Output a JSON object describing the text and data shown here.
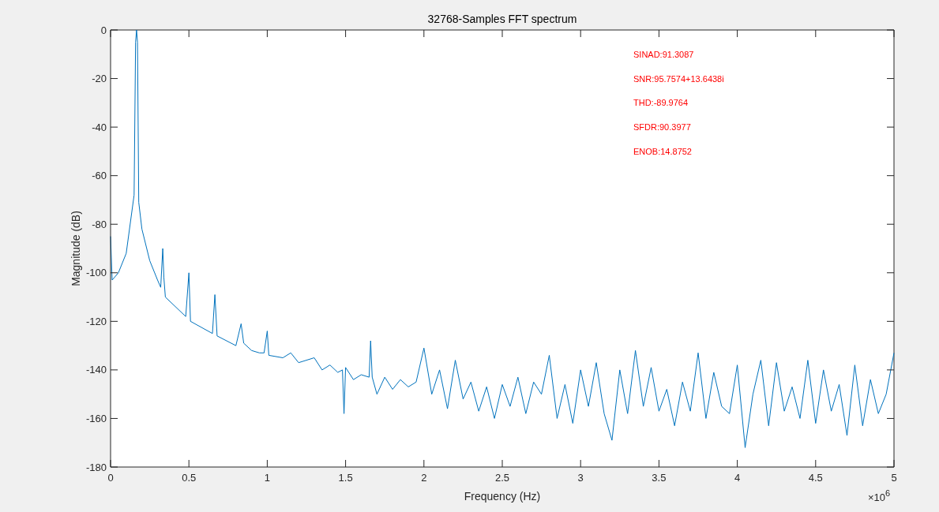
{
  "figure": {
    "x_exponent": "×10$^{6}$",
    "chart_data": {
      "type": "line",
      "title": "32768-Samples FFT spectrum",
      "xlabel": "Frequency (Hz)",
      "ylabel": "Magnitude (dB)",
      "x": [
        0,
        0.01,
        0.05,
        0.1,
        0.15,
        0.16,
        0.166,
        0.172,
        0.18,
        0.2,
        0.25,
        0.3,
        0.32,
        0.333,
        0.34,
        0.35,
        0.48,
        0.5,
        0.51,
        0.65,
        0.666,
        0.68,
        0.8,
        0.833,
        0.85,
        0.9,
        0.95,
        0.98,
        1.0,
        1.01,
        1.1,
        1.15,
        1.2,
        1.3,
        1.35,
        1.4,
        1.45,
        1.48,
        1.49,
        1.5,
        1.55,
        1.6,
        1.65,
        1.66,
        1.67,
        1.7,
        1.75,
        1.8,
        1.85,
        1.9,
        1.95,
        2.0,
        2.05,
        2.1,
        2.15,
        2.2,
        2.25,
        2.3,
        2.35,
        2.4,
        2.45,
        2.5,
        2.55,
        2.6,
        2.65,
        2.7,
        2.75,
        2.8,
        2.85,
        2.9,
        2.95,
        3.0,
        3.05,
        3.1,
        3.15,
        3.2,
        3.25,
        3.3,
        3.35,
        3.4,
        3.45,
        3.5,
        3.55,
        3.6,
        3.65,
        3.7,
        3.75,
        3.8,
        3.85,
        3.9,
        3.95,
        4.0,
        4.05,
        4.1,
        4.15,
        4.2,
        4.25,
        4.3,
        4.35,
        4.4,
        4.45,
        4.5,
        4.55,
        4.6,
        4.65,
        4.7,
        4.75,
        4.8,
        4.85,
        4.9,
        4.95,
        5.0
      ],
      "series": [
        {
          "color": "#0072bd",
          "values": [
            -85,
            -103,
            -100,
            -92,
            -68,
            -5,
            0,
            -5,
            -71,
            -82,
            -95,
            -103,
            -106,
            -90,
            -102,
            -110,
            -118,
            -100,
            -120,
            -125,
            -109,
            -126,
            -130,
            -121,
            -129,
            -132,
            -133,
            -133,
            -124,
            -134,
            -135,
            -133,
            -137,
            -135,
            -140,
            -138,
            -141,
            -140,
            -158,
            -139,
            -144,
            -142,
            -143,
            -128,
            -143,
            -150,
            -143,
            -148,
            -144,
            -147,
            -145,
            -131,
            -150,
            -140,
            -156,
            -136,
            -152,
            -145,
            -157,
            -147,
            -160,
            -146,
            -155,
            -143,
            -158,
            -145,
            -150,
            -134,
            -160,
            -146,
            -162,
            -140,
            -155,
            -137,
            -158,
            -169,
            -140,
            -158,
            -132,
            -155,
            -139,
            -157,
            -148,
            -163,
            -145,
            -157,
            -133,
            -160,
            -141,
            -155,
            -158,
            -138,
            -172,
            -150,
            -136,
            -163,
            -137,
            -157,
            -147,
            -160,
            -136,
            -162,
            -140,
            -157,
            -146,
            -167,
            -138,
            -163,
            -144,
            -158,
            -150,
            -133
          ]
        }
      ],
      "xlim": [
        0,
        5
      ],
      "ylim": [
        -180,
        0
      ],
      "xticks": [
        0,
        0.5,
        1,
        1.5,
        2,
        2.5,
        3,
        3.5,
        4,
        4.5,
        5
      ],
      "yticks": [
        -180,
        -160,
        -140,
        -120,
        -100,
        -80,
        -60,
        -40,
        -20,
        0
      ],
      "annotations": [
        "SINAD:91.3087",
        "SNR:95.7574+13.6438i",
        "THD:-89.9764",
        "SFDR:90.3977",
        "ENOB:14.8752"
      ]
    }
  }
}
